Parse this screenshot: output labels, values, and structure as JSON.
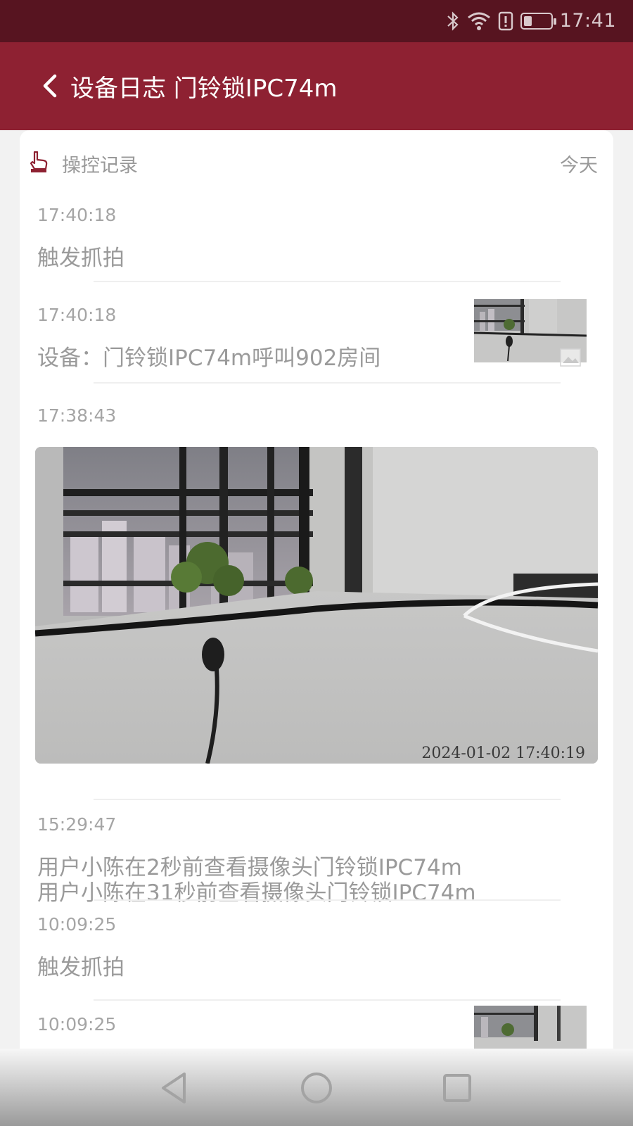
{
  "status_bar": {
    "time": "17:41",
    "battery_level": 0.3,
    "icons": [
      "bluetooth-icon",
      "wifi-icon",
      "alert-icon",
      "battery-icon"
    ]
  },
  "header": {
    "title": "设备日志 门铃锁IPC74m",
    "back_icon": "chevron-left-icon",
    "background": "#8e2132"
  },
  "log": {
    "section_title": "操控记录",
    "date_label": "今天",
    "entries": [
      {
        "time": "17:40:18",
        "message": "触发抓拍",
        "has_thumbnail": false
      },
      {
        "time": "17:40:18",
        "message": "设备：门铃锁IPC74m呼叫902房间",
        "has_thumbnail": true
      },
      {
        "time": "17:38:43",
        "message": "用户小陈在31秒前查看摄像头门铃锁IPC74m",
        "has_thumbnail": false
      },
      {
        "time": "15:29:47",
        "message": "用户小陈在2秒前查看摄像头门铃锁IPC74m",
        "has_thumbnail": false
      },
      {
        "time": "10:09:25",
        "message": "触发抓拍",
        "has_thumbnail": false
      },
      {
        "time": "10:09:25",
        "message": "",
        "has_thumbnail": true
      }
    ]
  },
  "preview": {
    "timestamp": "2024-01-02 17:40:19"
  },
  "nav_bar": {
    "buttons": [
      "back-triangle-icon",
      "home-circle-icon",
      "recents-square-icon"
    ]
  }
}
